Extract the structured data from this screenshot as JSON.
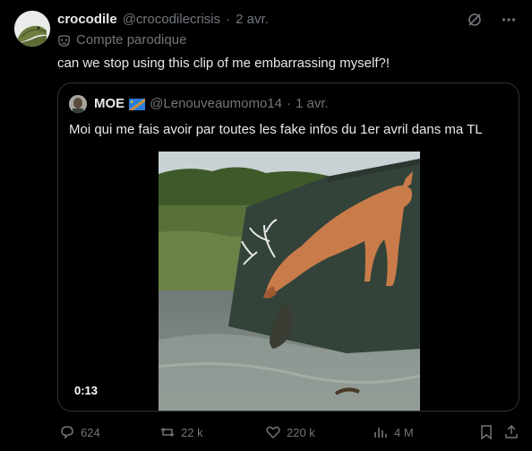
{
  "author": {
    "name": "crocodile",
    "handle": "@crocodilecrisis",
    "separator": "·",
    "date": "2 avr.",
    "badge_label": "Compte parodique",
    "icons": [
      "grok-icon",
      "more-icon",
      "parody-mask-icon"
    ]
  },
  "tweet": {
    "text": "can we stop using this clip of me embarrassing myself?!"
  },
  "quote": {
    "name": "MOE",
    "handle": "@Lenouveaumomo14",
    "separator": "·",
    "date": "1 avr.",
    "text": "Moi qui me fais avoir par toutes les fake infos du 1er avril dans ma TL",
    "video_time": "0:13"
  },
  "actions": {
    "replies": "624",
    "reposts": "22 k",
    "likes": "220 k",
    "views": "4 M"
  },
  "colors": {
    "background": "#000000",
    "text_primary": "#e7e9ea",
    "text_secondary": "#71767b",
    "border": "#2f3336"
  }
}
